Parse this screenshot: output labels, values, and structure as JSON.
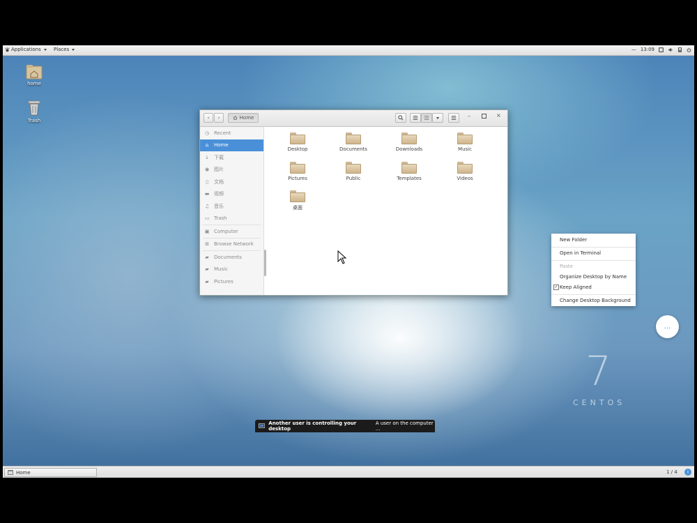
{
  "top_panel": {
    "applications_label": "Applications",
    "places_label": "Places",
    "time": "13:09"
  },
  "desktop": {
    "icons": [
      {
        "label": "home",
        "icon": "home-folder-icon"
      },
      {
        "label": "Trash",
        "icon": "trash-icon"
      }
    ],
    "branding_number": "7",
    "branding_word": "CENTOS"
  },
  "file_manager": {
    "location": "Home",
    "sidebar": [
      {
        "label": "Recent",
        "icon": "clock-icon"
      },
      {
        "label": "Home",
        "icon": "home-icon",
        "selected": true
      },
      {
        "label": "下载",
        "icon": "download-icon"
      },
      {
        "label": "图片",
        "icon": "camera-icon"
      },
      {
        "label": "文档",
        "icon": "document-icon"
      },
      {
        "label": "视频",
        "icon": "video-icon"
      },
      {
        "label": "音乐",
        "icon": "music-icon"
      },
      {
        "label": "Trash",
        "icon": "trash-icon"
      },
      {
        "label": "Computer",
        "icon": "computer-icon"
      },
      {
        "label": "Browse Network",
        "icon": "network-icon"
      },
      {
        "label": "Documents",
        "icon": "folder-icon"
      },
      {
        "label": "Music",
        "icon": "folder-icon"
      },
      {
        "label": "Pictures",
        "icon": "folder-icon"
      }
    ],
    "folders": [
      "Desktop",
      "Documents",
      "Downloads",
      "Music",
      "Pictures",
      "Public",
      "Templates",
      "Videos",
      "桌面"
    ]
  },
  "context_menu": {
    "items": [
      {
        "label": "New Folder"
      },
      {
        "label": "Open in Terminal"
      },
      {
        "label": "Paste",
        "disabled": true
      },
      {
        "label": "Organize Desktop by Name"
      },
      {
        "label": "Keep Aligned",
        "checked": true
      },
      {
        "label": "Change Desktop Background"
      }
    ]
  },
  "bottom_panel": {
    "task_label": "Home",
    "workspace": "1 / 4"
  },
  "notification": {
    "title": "Another user is controlling your desktop",
    "body": "A user on the computer ..."
  },
  "colors": {
    "selection": "#4a90d9",
    "panel": "#e6e6e6"
  }
}
